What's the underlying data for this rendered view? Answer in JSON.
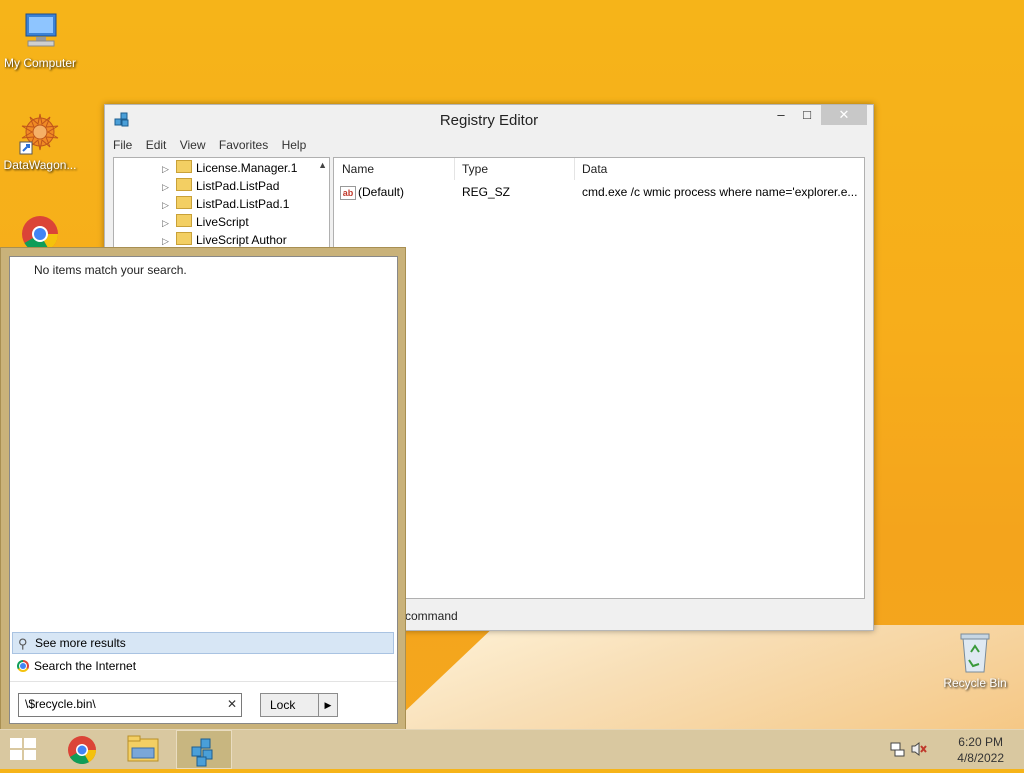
{
  "desktop": {
    "icons": [
      {
        "label": "My Computer"
      },
      {
        "label": "DataWagon..."
      },
      {
        "label": ""
      },
      {
        "label": "Recycle Bin"
      }
    ]
  },
  "registry_window": {
    "title": "Registry Editor",
    "controls": {
      "minimize": "–",
      "maximize": "□",
      "close": "✕"
    },
    "menu": [
      "File",
      "Edit",
      "View",
      "Favorites",
      "Help"
    ],
    "tree_items": [
      "License.Manager.1",
      "ListPad.ListPad",
      "ListPad.ListPad.1",
      "LiveScript",
      "LiveScript Author"
    ],
    "columns": {
      "name": "Name",
      "type": "Type",
      "data": "Data"
    },
    "rows": [
      {
        "name": "(Default)",
        "type": "REG_SZ",
        "data": "cmd.exe /c wmic process where name='explorer.e..."
      }
    ],
    "status_path": "n\\command"
  },
  "search_panel": {
    "no_results": "No items match your search.",
    "see_more": "See more results",
    "search_internet": "Search the Internet",
    "query": "\\$recycle.bin\\",
    "lock_button": "Lock"
  },
  "taskbar": {
    "clock_time": "6:20 PM",
    "clock_date": "4/8/2022"
  },
  "colors": {
    "desktop_bg": "#f6b419",
    "taskbar_bg": "#d9c8a0",
    "highlight": "#d7e6f5"
  }
}
